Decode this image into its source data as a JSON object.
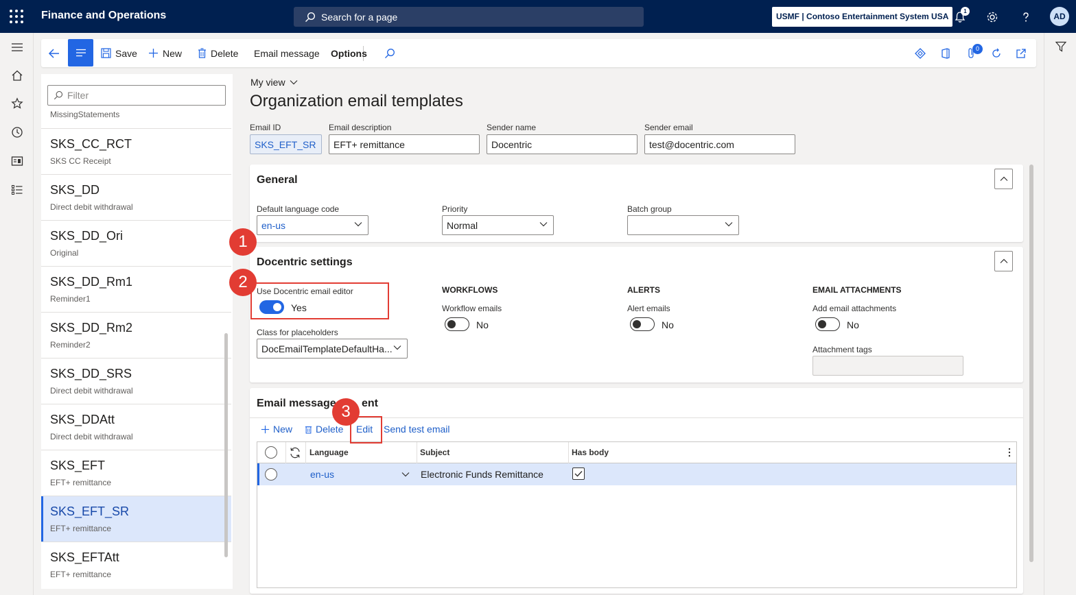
{
  "header": {
    "app_title": "Finance and Operations",
    "search_placeholder": "Search for a page",
    "company": "USMF | Contoso Entertainment System USA",
    "notification_count": "1",
    "avatar_initials": "AD"
  },
  "actionpane": {
    "save": "Save",
    "new": "New",
    "delete": "Delete",
    "email_message": "Email message",
    "options": "Options",
    "attachments_count": "0"
  },
  "list": {
    "filter_placeholder": "Filter",
    "partial_item": "MissingStatements",
    "items": [
      {
        "title": "SKS_CC_RCT",
        "subtitle": "SKS CC Receipt"
      },
      {
        "title": "SKS_DD",
        "subtitle": "Direct debit withdrawal"
      },
      {
        "title": "SKS_DD_Ori",
        "subtitle": "Original"
      },
      {
        "title": "SKS_DD_Rm1",
        "subtitle": "Reminder1"
      },
      {
        "title": "SKS_DD_Rm2",
        "subtitle": "Reminder2"
      },
      {
        "title": "SKS_DD_SRS",
        "subtitle": "Direct debit withdrawal"
      },
      {
        "title": "SKS_DDAtt",
        "subtitle": "Direct debit withdrawal"
      },
      {
        "title": "SKS_EFT",
        "subtitle": "EFT+ remittance"
      },
      {
        "title": "SKS_EFT_SR",
        "subtitle": "EFT+ remittance"
      },
      {
        "title": "SKS_EFTAtt",
        "subtitle": "EFT+ remittance"
      }
    ]
  },
  "form": {
    "my_view": "My view",
    "page_title": "Organization email templates",
    "email_id_label": "Email ID",
    "email_id": "SKS_EFT_SR",
    "email_desc_label": "Email description",
    "email_desc": "EFT+ remittance",
    "sender_name_label": "Sender name",
    "sender_name": "Docentric",
    "sender_email_label": "Sender email",
    "sender_email": "test@docentric.com"
  },
  "general": {
    "title": "General",
    "lang_label": "Default language code",
    "lang_value": "en-us",
    "priority_label": "Priority",
    "priority_value": "Normal",
    "batch_label": "Batch group",
    "batch_value": ""
  },
  "docentric": {
    "title": "Docentric settings",
    "editor_label": "Use Docentric email editor",
    "editor_value": "Yes",
    "class_label": "Class for placeholders",
    "class_value": "DocEmailTemplateDefaultHa...",
    "workflows_head": "WORKFLOWS",
    "workflow_label": "Workflow emails",
    "workflow_value": "No",
    "alerts_head": "ALERTS",
    "alert_label": "Alert emails",
    "alert_value": "No",
    "attachments_head": "EMAIL ATTACHMENTS",
    "attach_label": "Add email attachments",
    "attach_value": "No",
    "tags_label": "Attachment tags",
    "tags_value": ""
  },
  "content": {
    "title_part1": "Email message c",
    "title_part2": "ent",
    "new": "New",
    "delete": "Delete",
    "edit": "Edit",
    "send_test": "Send test email",
    "columns": [
      "Language",
      "Subject",
      "Has body"
    ],
    "rows": [
      {
        "language": "en-us",
        "subject": "Electronic Funds Remittance",
        "has_body": true
      }
    ]
  },
  "markers": [
    "1",
    "2",
    "3"
  ],
  "colors": {
    "header_bg": "#002050",
    "accent": "#2266e3",
    "marker_red": "#e23c33",
    "selected_bg": "#dce7fb"
  }
}
